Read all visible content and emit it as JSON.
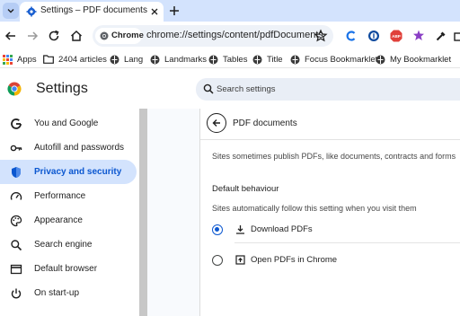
{
  "tab": {
    "title": "Settings – PDF documents"
  },
  "toolbar": {
    "chip_label": "Chrome",
    "url": "chrome://settings/content/pdfDocuments",
    "extensions": [
      "c-extension-icon",
      "password-manager-icon",
      "adblock-icon",
      "puzzle-extension-icon",
      "eyedropper-icon",
      "extensions-icon"
    ]
  },
  "bookmarks": {
    "items": [
      {
        "label": "Apps",
        "icon": "apps-grid-icon"
      },
      {
        "label": "2404 articles",
        "icon": "folder-icon"
      },
      {
        "label": "Lang",
        "icon": "bookmarklet-icon"
      },
      {
        "label": "Landmarks",
        "icon": "bookmarklet-icon"
      },
      {
        "label": "Tables",
        "icon": "bookmarklet-icon"
      },
      {
        "label": "Title",
        "icon": "bookmarklet-icon"
      },
      {
        "label": "Focus Bookmarklet",
        "icon": "bookmarklet-icon"
      },
      {
        "label": "My Bookmarklet",
        "icon": "bookmarklet-icon"
      }
    ]
  },
  "header": {
    "title": "Settings",
    "search_placeholder": "Search settings"
  },
  "sidebar": {
    "items": [
      {
        "label": "You and Google",
        "icon": "google-g-icon",
        "active": false
      },
      {
        "label": "Autofill and passwords",
        "icon": "key-icon",
        "active": false
      },
      {
        "label": "Privacy and security",
        "icon": "shield-icon",
        "active": true
      },
      {
        "label": "Performance",
        "icon": "speedometer-icon",
        "active": false
      },
      {
        "label": "Appearance",
        "icon": "palette-icon",
        "active": false
      },
      {
        "label": "Search engine",
        "icon": "search-icon",
        "active": false
      },
      {
        "label": "Default browser",
        "icon": "browser-window-icon",
        "active": false
      },
      {
        "label": "On start-up",
        "icon": "power-icon",
        "active": false
      }
    ]
  },
  "main": {
    "title": "PDF documents",
    "description": "Sites sometimes publish PDFs, like documents, contracts and forms",
    "section_heading": "Default behaviour",
    "section_subtitle": "Sites automatically follow this setting when you visit them",
    "options": [
      {
        "label": "Download PDFs",
        "icon": "download-icon",
        "selected": true
      },
      {
        "label": "Open PDFs in Chrome",
        "icon": "open-in-chrome-icon",
        "selected": false
      }
    ]
  },
  "colors": {
    "accent": "#0b57d0",
    "active_nav_bg": "#d3e3fd",
    "tabstrip_bg": "#d3e3fd"
  }
}
